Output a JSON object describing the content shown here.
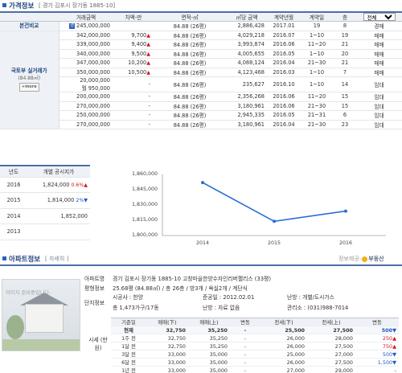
{
  "price_section": {
    "title": "가격정보",
    "address": "[ 경기 김포시 장기동 1885-10]"
  },
  "price_table": {
    "headers": [
      "거래금액",
      "차액-만",
      "면적-㎡",
      "㎡당 금액",
      "계약년월",
      "계약일",
      "층"
    ],
    "filter_selected": "전체",
    "compare_label": "본건비교",
    "compare_row": {
      "badge": "경",
      "amount": "245,000,000",
      "diff": "",
      "area": "84.88",
      "area_unit": "(26평)",
      "per_m2": "2,886,428",
      "ym": "2017.01",
      "day": "19",
      "floor": "8",
      "type": "경매"
    },
    "group_label": "국토부 실거래가",
    "group_sub": "(84.88㎡)",
    "more_label": "+more",
    "rows": [
      {
        "amount": "342,000,000",
        "diff": "9,700",
        "dir": "up",
        "area": "84.88",
        "area_unit": "(26평)",
        "per_m2": "4,029,218",
        "ym": "2016.07",
        "day": "1~10",
        "floor": "19",
        "type": "매매"
      },
      {
        "amount": "339,000,000",
        "diff": "9,400",
        "dir": "up",
        "area": "84.88",
        "area_unit": "(26평)",
        "per_m2": "3,993,874",
        "ym": "2016.06",
        "day": "11~20",
        "floor": "21",
        "type": "매매"
      },
      {
        "amount": "340,000,000",
        "diff": "9,500",
        "dir": "up",
        "area": "84.88",
        "area_unit": "(26평)",
        "per_m2": "4,005,655",
        "ym": "2016.05",
        "day": "1~10",
        "floor": "20",
        "type": "매매"
      },
      {
        "amount": "347,000,000",
        "diff": "10,200",
        "dir": "up",
        "area": "84.88",
        "area_unit": "(26평)",
        "per_m2": "4,088,124",
        "ym": "2016.04",
        "day": "21~30",
        "floor": "21",
        "type": "매매"
      },
      {
        "amount": "350,000,000",
        "diff": "10,500",
        "dir": "up",
        "area": "84.88",
        "area_unit": "(26평)",
        "per_m2": "4,123,468",
        "ym": "2016.03",
        "day": "1~10",
        "floor": "7",
        "type": "매매"
      },
      {
        "amount": "20,000,000",
        "amount2": "월 950,000",
        "diff": "-",
        "dir": "",
        "area": "84.88",
        "area_unit": "(26평)",
        "per_m2": "235,627",
        "ym": "2016.10",
        "day": "1~10",
        "floor": "14",
        "type": "임대",
        "dual": true
      },
      {
        "amount": "200,000,000",
        "diff": "-",
        "dir": "",
        "area": "84.88",
        "area_unit": "(26평)",
        "per_m2": "2,356,268",
        "ym": "2016.06",
        "day": "11~20",
        "floor": "15",
        "type": "임대"
      },
      {
        "amount": "270,000,000",
        "diff": "-",
        "dir": "",
        "area": "84.88",
        "area_unit": "(26평)",
        "per_m2": "3,180,961",
        "ym": "2016.06",
        "day": "21~30",
        "floor": "15",
        "type": "임대"
      },
      {
        "amount": "250,000,000",
        "diff": "-",
        "dir": "",
        "area": "84.88",
        "area_unit": "(26평)",
        "per_m2": "2,945,335",
        "ym": "2016.05",
        "day": "21~31",
        "floor": "6",
        "type": "임대"
      },
      {
        "amount": "270,000,000",
        "diff": "-",
        "dir": "",
        "area": "84.88",
        "area_unit": "(26평)",
        "per_m2": "3,180,961",
        "ym": "2016.04",
        "day": "21~30",
        "floor": "23",
        "type": "임대"
      }
    ]
  },
  "public_price": {
    "headers": [
      "년도",
      "개별 공시지가"
    ],
    "rows": [
      {
        "year": "2016",
        "value": "1,824,000",
        "pct": "0.6%",
        "dir": "up"
      },
      {
        "year": "2015",
        "value": "1,814,000",
        "pct": "2%",
        "dir": "down"
      },
      {
        "year": "2014",
        "value": "1,852,000",
        "pct": "",
        "dir": ""
      },
      {
        "year": "2013",
        "value": "",
        "pct": "",
        "dir": ""
      }
    ]
  },
  "chart_data": {
    "type": "line",
    "x": [
      "2014",
      "2015",
      "2016"
    ],
    "values": [
      1852000,
      1814000,
      1824000
    ],
    "yticks": [
      "1,860,000",
      "1,845,000",
      "1,830,000",
      "1,815,000",
      "1,800,000"
    ],
    "ylim": [
      1800000,
      1860000
    ],
    "grid": false,
    "color": "#2a6fd4"
  },
  "apt_section": {
    "title": "아파트정보",
    "detail_link": "[ 자세히 ]",
    "source_prefix": "정보제공-",
    "source_name": "부동산",
    "photo_text": "이미지 준비중입니다.",
    "name_label": "아파트명",
    "name_value": "경기 김포시 장기동 1885-10 고창마을한양수자인리버팰리스 (33평)",
    "pyeong_label": "평형정보",
    "pyeong_value": "25.68평 (84.88㎡) / 총 26층 / 방3개 / 욕실2개 / 계단식",
    "complex_label": "단지정보",
    "builder_label": "시공사 : 한양",
    "completion_label": "준공일 : 2012.02.01",
    "heating_label": "난방 : 개별/도시가스",
    "households_label": "총 1,473가구/17동",
    "parking_label": "난방 : 자료 없음",
    "office_label": "관리소 : (031)988-7014",
    "market_label": "시세 (만원)"
  },
  "market_table": {
    "headers": [
      "기준일",
      "매매(下)",
      "매매(上)",
      "변동",
      "전세(下)",
      "전세(上)",
      "변동"
    ],
    "rows": [
      {
        "when": "현재",
        "s_lo": "32,750",
        "s_hi": "35,250",
        "s_chg": "-",
        "s_dir": "",
        "j_lo": "25,500",
        "j_hi": "27,500",
        "j_chg": "500▼",
        "j_dir": "dn",
        "cur": true
      },
      {
        "when": "1주 전",
        "s_lo": "32,750",
        "s_hi": "35,250",
        "s_chg": "-",
        "s_dir": "",
        "j_lo": "26,000",
        "j_hi": "28,000",
        "j_chg": "250▲",
        "j_dir": "up"
      },
      {
        "when": "1달 전",
        "s_lo": "32,750",
        "s_hi": "35,250",
        "s_chg": "-",
        "s_dir": "",
        "j_lo": "26,000",
        "j_hi": "27,500",
        "j_chg": "750▲",
        "j_dir": "up"
      },
      {
        "when": "3달 전",
        "s_lo": "33,000",
        "s_hi": "35,000",
        "s_chg": "-",
        "s_dir": "",
        "j_lo": "25,000",
        "j_hi": "27,000",
        "j_chg": "500▼",
        "j_dir": "dn"
      },
      {
        "when": "6달 전",
        "s_lo": "33,000",
        "s_hi": "35,000",
        "s_chg": "-",
        "s_dir": "",
        "j_lo": "26,000",
        "j_hi": "27,500",
        "j_chg": "1,500▼",
        "j_dir": "dn"
      },
      {
        "when": "1년 전",
        "s_lo": "33,000",
        "s_hi": "35,000",
        "s_chg": "-",
        "s_dir": "",
        "j_lo": "27,000",
        "j_hi": "29,000",
        "j_chg": "-",
        "j_dir": ""
      }
    ]
  }
}
